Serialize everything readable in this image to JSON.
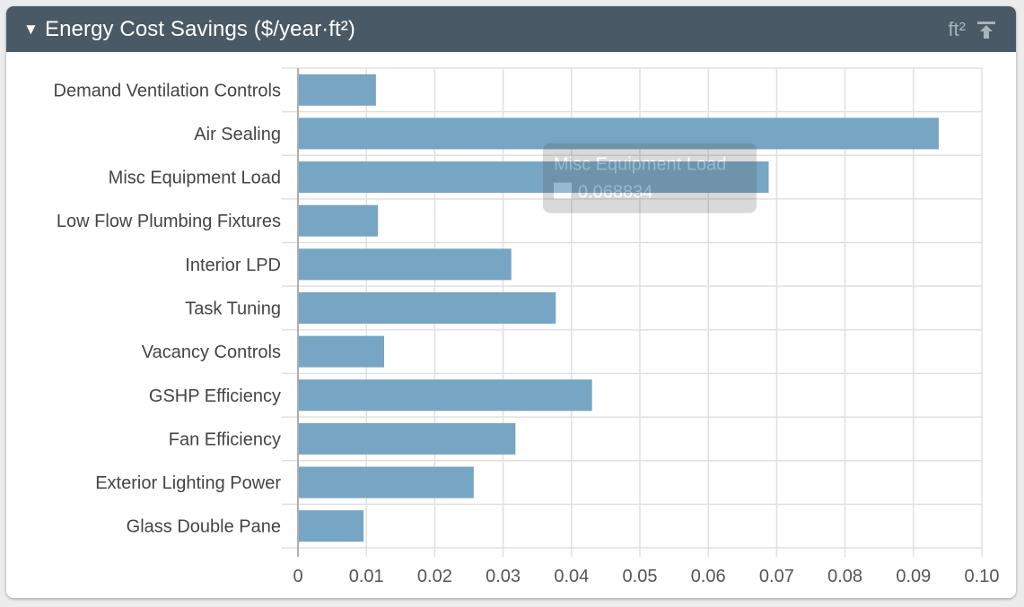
{
  "header": {
    "toggle_icon": "caret-down-icon",
    "title": "Energy Cost Savings ($/year·ft²)",
    "unit_label": "ft²",
    "pin_icon": "pin-to-top-icon"
  },
  "tooltip": {
    "category": "Misc Equipment Load",
    "value": "0.068834"
  },
  "colors": {
    "header_bg": "#495a66",
    "bar": "#77a5c4",
    "grid": "#e0e0e0"
  },
  "chart_data": {
    "type": "bar",
    "orientation": "horizontal",
    "title": "Energy Cost Savings ($/year·ft²)",
    "xlabel": "",
    "ylabel": "",
    "categories": [
      "Demand Ventilation Controls",
      "Air Sealing",
      "Misc Equipment Load",
      "Low Flow Plumbing Fixtures",
      "Interior LPD",
      "Task Tuning",
      "Vacancy Controls",
      "GSHP Efficiency",
      "Fan Efficiency",
      "Exterior Lighting Power",
      "Glass Double Pane"
    ],
    "values": [
      0.0114,
      0.0937,
      0.068834,
      0.0117,
      0.0312,
      0.0377,
      0.0126,
      0.043,
      0.0318,
      0.0257,
      0.0096
    ],
    "xlim": [
      0,
      0.1
    ],
    "xticks": [
      "0",
      "0.01",
      "0.02",
      "0.03",
      "0.04",
      "0.05",
      "0.06",
      "0.07",
      "0.08",
      "0.09",
      "0.10"
    ],
    "grid": true,
    "legend": "none"
  }
}
